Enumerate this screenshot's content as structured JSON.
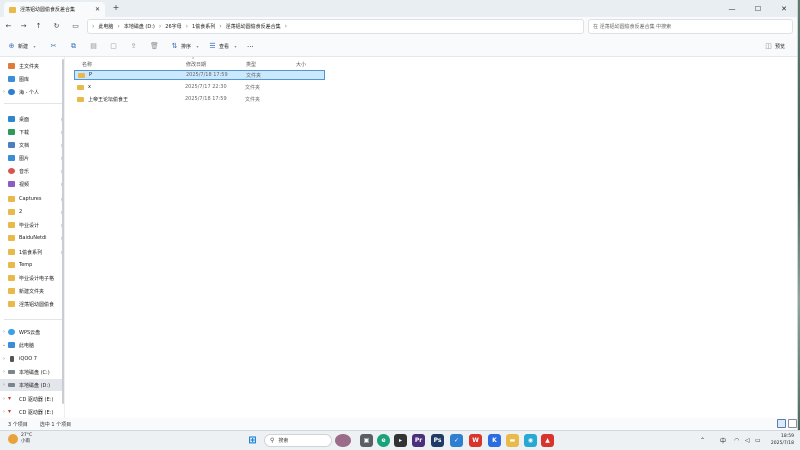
{
  "window": {
    "tab_title": "淫荡铝幼圆偷食反差合集",
    "new_tab": "+",
    "controls": [
      "—",
      "☐",
      "✕"
    ]
  },
  "nav": {
    "breadcrumb": [
      "此电脑",
      "本地磁盘 (D:)",
      "26字母",
      "1偷食系列",
      "淫荡铝幼圆偷食反差合集"
    ],
    "search_placeholder": "在 淫荡铝幼圆偷食反差合集 中搜索"
  },
  "toolbar": {
    "new_label": "新建",
    "sort_label": "排序",
    "view_label": "查看",
    "more_label": "···",
    "preview_label": "预览"
  },
  "sidebar": {
    "top_items": [
      {
        "label": "主文件夹",
        "icon": "home-icon"
      },
      {
        "label": "图库",
        "icon": "gallery-icon"
      },
      {
        "label": "海 - 个人",
        "icon": "cloud-icon"
      }
    ],
    "quick_access": [
      {
        "label": "桌面",
        "icon": "desktop-icon"
      },
      {
        "label": "下载",
        "icon": "download-icon"
      },
      {
        "label": "文档",
        "icon": "document-icon"
      },
      {
        "label": "图片",
        "icon": "picture-icon"
      },
      {
        "label": "音乐",
        "icon": "music-icon"
      },
      {
        "label": "视频",
        "icon": "video-icon"
      },
      {
        "label": "Captures",
        "icon": "folder-icon"
      },
      {
        "label": "2",
        "icon": "folder-icon"
      },
      {
        "label": "毕业设计",
        "icon": "folder-icon"
      },
      {
        "label": "BaiduNetdi",
        "icon": "folder-icon"
      },
      {
        "label": "1偷食系列",
        "icon": "folder-icon"
      },
      {
        "label": "Temp",
        "icon": "folder-icon"
      },
      {
        "label": "毕业设计电子格",
        "icon": "folder-icon"
      },
      {
        "label": "新建文件夹",
        "icon": "folder-icon"
      },
      {
        "label": "淫荡铝幼圆偷食",
        "icon": "folder-icon"
      }
    ],
    "drives": [
      {
        "label": "WPS云盘",
        "icon": "cloud-icon"
      },
      {
        "label": "此电脑",
        "icon": "pc-icon"
      },
      {
        "label": "iQOO 7",
        "icon": "phone-icon"
      },
      {
        "label": "本地磁盘 (C:)",
        "icon": "drive-icon"
      },
      {
        "label": "本地磁盘 (D:)",
        "icon": "drive-icon"
      },
      {
        "label": "CD 驱动器 (E:)",
        "icon": "cd-icon"
      },
      {
        "label": "CD 驱动器 (E:)",
        "icon": "cd-icon"
      }
    ]
  },
  "columns": [
    "名称",
    "修改日期",
    "类型",
    "大小"
  ],
  "files": [
    {
      "name": "P",
      "date": "2025/7/18 17:59",
      "type": "文件夹"
    },
    {
      "name": "x",
      "date": "2025/7/17 22:30",
      "type": "文件夹"
    },
    {
      "name": "上帝王论坛偷食王",
      "date": "2025/7/18 17:59",
      "type": "文件夹"
    }
  ],
  "status": {
    "count": "3 个项目",
    "selected": "选中 1 个项目"
  },
  "taskbar": {
    "weather_temp": "27°C",
    "weather_desc": "小雨",
    "search_label": "搜索",
    "ime": "中",
    "time": "18:59",
    "date": "2025/7/18",
    "colors": {
      "accent": "#0078d4",
      "folder": "#e9b949",
      "selection": "#cce8ff"
    }
  }
}
